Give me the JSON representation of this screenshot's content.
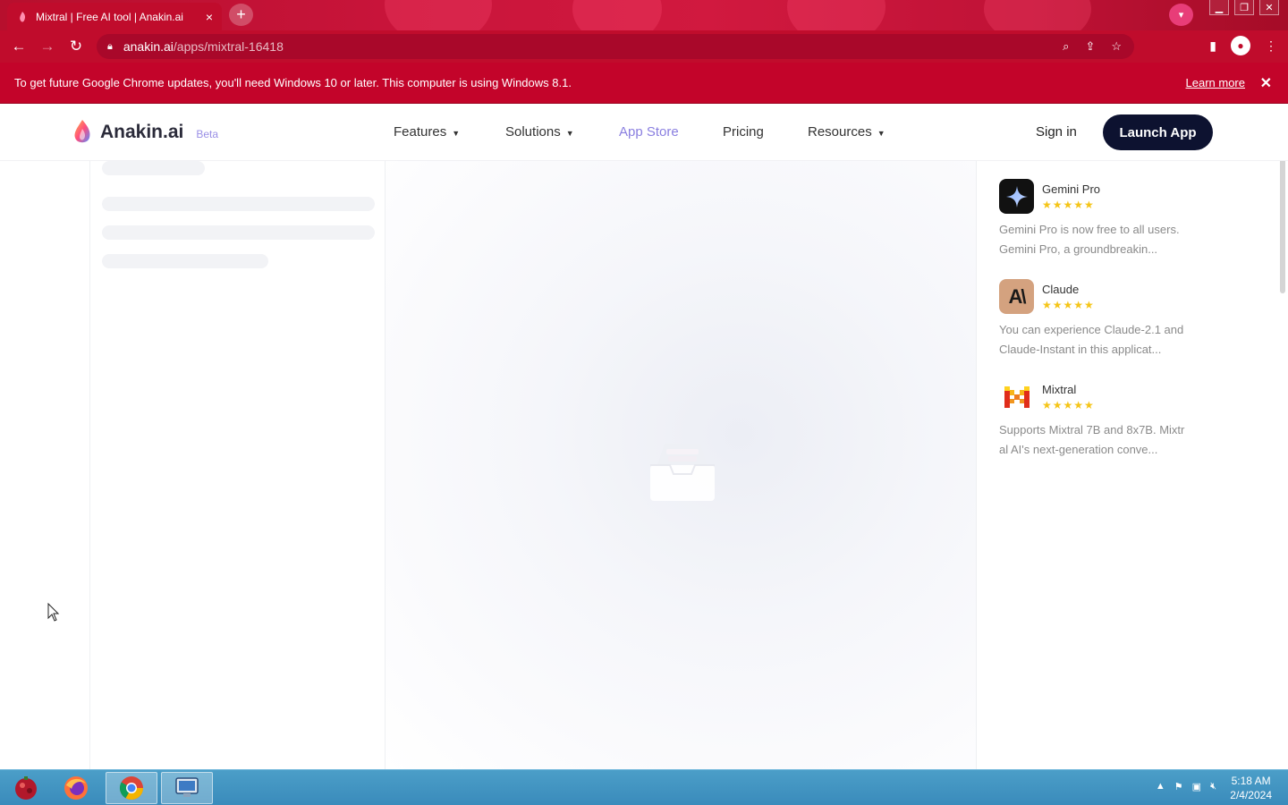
{
  "browser": {
    "tab_title": "Mixtral | Free AI tool | Anakin.ai",
    "tab_close": "×",
    "new_tab": "+",
    "url_host": "anakin.ai",
    "url_path": "/apps/mixtral-16418",
    "infobar_message": "To get future Google Chrome updates, you'll need Windows 10 or later. This computer is using Windows 8.1.",
    "infobar_link": "Learn more",
    "infobar_close": "✕"
  },
  "site": {
    "logo_text": "Anakin.ai",
    "beta_label": "Beta",
    "nav": [
      {
        "label": "Features"
      },
      {
        "label": "Solutions"
      },
      {
        "label": "App Store"
      },
      {
        "label": "Pricing"
      },
      {
        "label": "Resources"
      }
    ],
    "signin": "Sign in",
    "launch": "Launch App"
  },
  "apps": [
    {
      "name": "Gemini Pro",
      "rating": "★★★★★",
      "description": "Gemini Pro is now free to all users. Gemini Pro, a groundbreakin..."
    },
    {
      "name": "Claude",
      "rating": "★★★★★",
      "description": "You can experience Claude-2.1 and Claude-Instant in this applicat..."
    },
    {
      "name": "Mixtral",
      "rating": "★★★★★",
      "description": "Supports Mixtral 7B and 8x7B. Mixtral AI's next-generation conve..."
    }
  ],
  "taskbar": {
    "time": "5:18 AM",
    "date": "2/4/2024"
  },
  "colors": {
    "chrome_red": "#c00c2c",
    "launch_bg": "#0d1230",
    "accent": "#8a7fe0",
    "star": "#f5c518"
  }
}
